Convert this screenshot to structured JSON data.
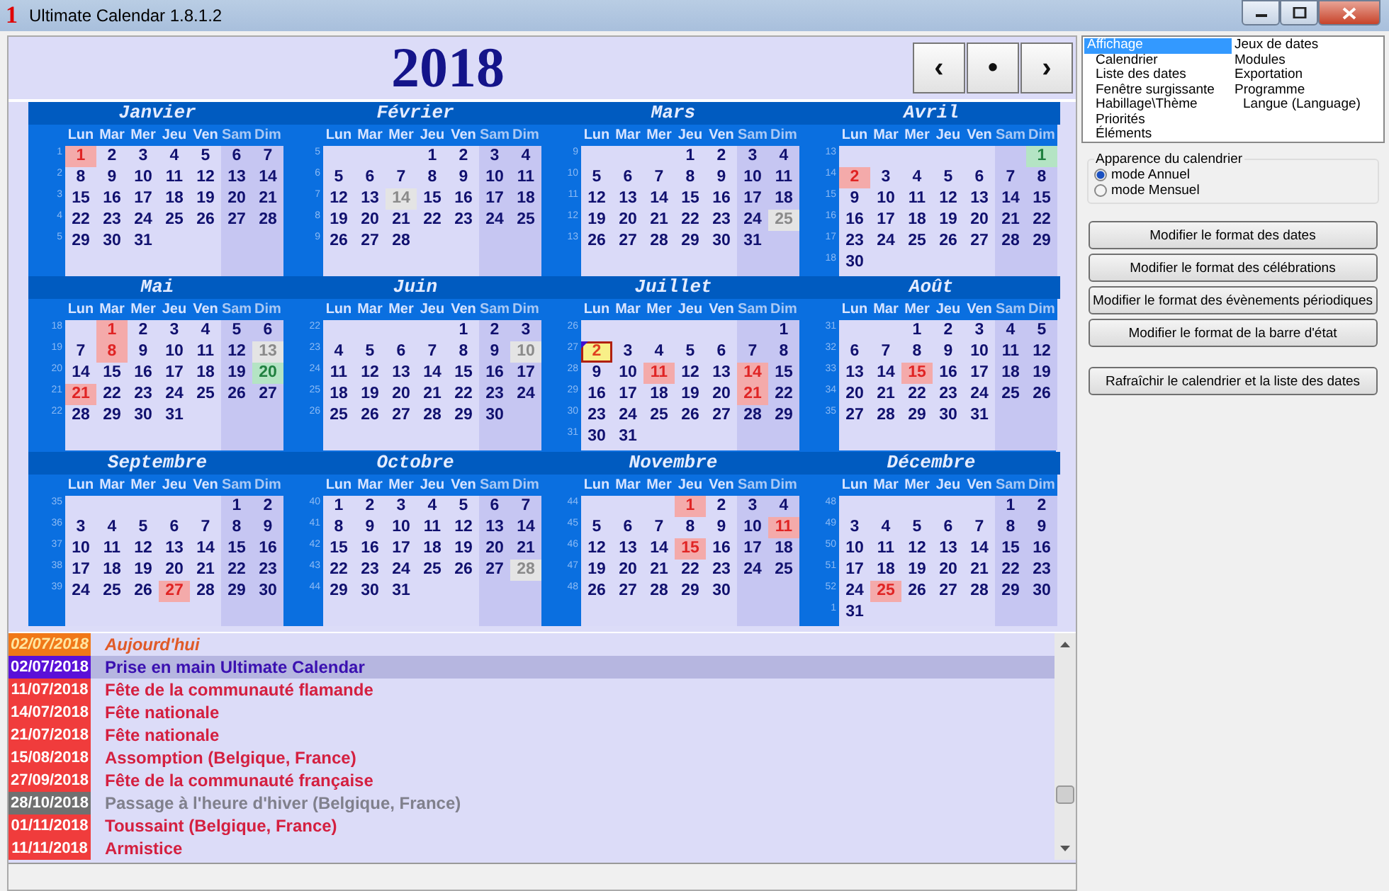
{
  "window": {
    "title": "Ultimate Calendar 1.8.1.2",
    "icon_text": "1"
  },
  "year": "2018",
  "nav_buttons": [
    "‹",
    "•",
    "›"
  ],
  "months": [
    {
      "name": "Janvier",
      "weekdays": [
        "Lun",
        "Mar",
        "Mer",
        "Jeu",
        "Ven",
        "Sam",
        "Dim"
      ],
      "weeks": [
        {
          "number": "1",
          "days": [
            {
              "d": "1",
              "kind": "holiday"
            },
            "2",
            "3",
            "4",
            "5",
            "6",
            "7"
          ]
        },
        {
          "number": "2",
          "days": [
            "8",
            "9",
            "10",
            "11",
            "12",
            "13",
            "14"
          ]
        },
        {
          "number": "3",
          "days": [
            "15",
            "16",
            "17",
            "18",
            "19",
            "20",
            "21"
          ]
        },
        {
          "number": "4",
          "days": [
            "22",
            "23",
            "24",
            "25",
            "26",
            "27",
            "28"
          ]
        },
        {
          "number": "5",
          "days": [
            "29",
            "30",
            "31"
          ]
        }
      ]
    },
    {
      "name": "Février",
      "weekdays": [
        "Lun",
        "Mar",
        "Mer",
        "Jeu",
        "Ven",
        "Sam",
        "Dim"
      ],
      "weeks": [
        {
          "number": "5",
          "days": [
            "1",
            "2",
            "3",
            "4"
          ]
        },
        {
          "number": "6",
          "days": [
            "5",
            "6",
            "7",
            "8",
            "9",
            "10",
            "11"
          ]
        },
        {
          "number": "7",
          "days": [
            "12",
            "13",
            {
              "d": "14",
              "kind": "muted"
            },
            "15",
            "16",
            "17",
            "18"
          ]
        },
        {
          "number": "8",
          "days": [
            "19",
            "20",
            "21",
            "22",
            "23",
            "24",
            "25"
          ]
        },
        {
          "number": "9",
          "days": [
            "26",
            "27",
            "28"
          ]
        }
      ]
    },
    {
      "name": "Mars",
      "weekdays": [
        "Lun",
        "Mar",
        "Mer",
        "Jeu",
        "Ven",
        "Sam",
        "Dim"
      ],
      "weeks": [
        {
          "number": "9",
          "days": [
            "1",
            "2",
            "3",
            "4"
          ]
        },
        {
          "number": "10",
          "days": [
            "5",
            "6",
            "7",
            "8",
            "9",
            "10",
            "11"
          ]
        },
        {
          "number": "11",
          "days": [
            "12",
            "13",
            "14",
            "15",
            "16",
            "17",
            "18"
          ]
        },
        {
          "number": "12",
          "days": [
            "19",
            "20",
            "21",
            "22",
            "23",
            "24",
            {
              "d": "25",
              "kind": "muted"
            }
          ]
        },
        {
          "number": "13",
          "days": [
            "26",
            "27",
            "28",
            "29",
            "30",
            "31"
          ]
        }
      ]
    },
    {
      "name": "Avril",
      "weekdays": [
        "Lun",
        "Mar",
        "Mer",
        "Jeu",
        "Ven",
        "Sam",
        "Dim"
      ],
      "weeks": [
        {
          "number": "13",
          "days": [
            {
              "d": "1",
              "kind": "green"
            }
          ]
        },
        {
          "number": "14",
          "days": [
            {
              "d": "2",
              "kind": "holiday"
            },
            "3",
            "4",
            "5",
            "6",
            "7",
            "8"
          ]
        },
        {
          "number": "15",
          "days": [
            "9",
            "10",
            "11",
            "12",
            "13",
            "14",
            "15"
          ]
        },
        {
          "number": "16",
          "days": [
            "16",
            "17",
            "18",
            "19",
            "20",
            "21",
            "22"
          ]
        },
        {
          "number": "17",
          "days": [
            "23",
            "24",
            "25",
            "26",
            "27",
            "28",
            "29"
          ]
        },
        {
          "number": "18",
          "days": [
            "30"
          ]
        }
      ]
    },
    {
      "name": "Mai",
      "weekdays": [
        "Lun",
        "Mar",
        "Mer",
        "Jeu",
        "Ven",
        "Sam",
        "Dim"
      ],
      "weeks": [
        {
          "number": "18",
          "days": [
            {
              "d": "1",
              "kind": "holiday"
            },
            "2",
            "3",
            "4",
            "5",
            "6"
          ]
        },
        {
          "number": "19",
          "days": [
            "7",
            {
              "d": "8",
              "kind": "holiday"
            },
            "9",
            "10",
            "11",
            "12",
            {
              "d": "13",
              "kind": "muted"
            }
          ]
        },
        {
          "number": "20",
          "days": [
            "14",
            "15",
            "16",
            "17",
            "18",
            "19",
            {
              "d": "20",
              "kind": "green"
            }
          ]
        },
        {
          "number": "21",
          "days": [
            {
              "d": "21",
              "kind": "holiday"
            },
            "22",
            "23",
            "24",
            "25",
            "26",
            "27"
          ]
        },
        {
          "number": "22",
          "days": [
            "28",
            "29",
            "30",
            "31"
          ]
        }
      ]
    },
    {
      "name": "Juin",
      "weekdays": [
        "Lun",
        "Mar",
        "Mer",
        "Jeu",
        "Ven",
        "Sam",
        "Dim"
      ],
      "weeks": [
        {
          "number": "22",
          "days": [
            "1",
            "2",
            "3"
          ]
        },
        {
          "number": "23",
          "days": [
            "4",
            "5",
            "6",
            "7",
            "8",
            "9",
            {
              "d": "10",
              "kind": "muted"
            }
          ]
        },
        {
          "number": "24",
          "days": [
            "11",
            "12",
            "13",
            "14",
            "15",
            "16",
            "17"
          ]
        },
        {
          "number": "25",
          "days": [
            "18",
            "19",
            "20",
            "21",
            "22",
            "23",
            "24"
          ]
        },
        {
          "number": "26",
          "days": [
            "25",
            "26",
            "27",
            "28",
            "29",
            "30"
          ]
        }
      ]
    },
    {
      "name": "Juillet",
      "weekdays": [
        "Lun",
        "Mar",
        "Mer",
        "Jeu",
        "Ven",
        "Sam",
        "Dim"
      ],
      "weeks": [
        {
          "number": "26",
          "days": [
            "1"
          ]
        },
        {
          "number": "27",
          "days": [
            {
              "d": "2",
              "kind": "today",
              "event": true
            },
            "3",
            "4",
            "5",
            "6",
            "7",
            "8"
          ]
        },
        {
          "number": "28",
          "days": [
            "9",
            "10",
            {
              "d": "11",
              "kind": "holiday"
            },
            "12",
            "13",
            {
              "d": "14",
              "kind": "holiday"
            },
            "15"
          ]
        },
        {
          "number": "29",
          "days": [
            "16",
            "17",
            "18",
            "19",
            "20",
            {
              "d": "21",
              "kind": "holiday"
            },
            "22"
          ]
        },
        {
          "number": "30",
          "days": [
            "23",
            "24",
            "25",
            "26",
            "27",
            "28",
            "29"
          ]
        },
        {
          "number": "31",
          "days": [
            "30",
            "31"
          ]
        }
      ]
    },
    {
      "name": "Août",
      "weekdays": [
        "Lun",
        "Mar",
        "Mer",
        "Jeu",
        "Ven",
        "Sam",
        "Dim"
      ],
      "weeks": [
        {
          "number": "31",
          "days": [
            "1",
            "2",
            "3",
            "4",
            "5"
          ]
        },
        {
          "number": "32",
          "days": [
            "6",
            "7",
            "8",
            "9",
            "10",
            "11",
            "12"
          ]
        },
        {
          "number": "33",
          "days": [
            "13",
            "14",
            {
              "d": "15",
              "kind": "holiday"
            },
            "16",
            "17",
            "18",
            "19"
          ]
        },
        {
          "number": "34",
          "days": [
            "20",
            "21",
            "22",
            "23",
            "24",
            "25",
            "26"
          ]
        },
        {
          "number": "35",
          "days": [
            "27",
            "28",
            "29",
            "30",
            "31"
          ]
        }
      ]
    },
    {
      "name": "Septembre",
      "weekdays": [
        "Lun",
        "Mar",
        "Mer",
        "Jeu",
        "Ven",
        "Sam",
        "Dim"
      ],
      "weeks": [
        {
          "number": "35",
          "days": [
            "1",
            "2"
          ]
        },
        {
          "number": "36",
          "days": [
            "3",
            "4",
            "5",
            "6",
            "7",
            "8",
            "9"
          ]
        },
        {
          "number": "37",
          "days": [
            "10",
            "11",
            "12",
            "13",
            "14",
            "15",
            "16"
          ]
        },
        {
          "number": "38",
          "days": [
            "17",
            "18",
            "19",
            "20",
            "21",
            "22",
            "23"
          ]
        },
        {
          "number": "39",
          "days": [
            "24",
            "25",
            "26",
            {
              "d": "27",
              "kind": "holiday"
            },
            "28",
            "29",
            "30"
          ]
        }
      ]
    },
    {
      "name": "Octobre",
      "weekdays": [
        "Lun",
        "Mar",
        "Mer",
        "Jeu",
        "Ven",
        "Sam",
        "Dim"
      ],
      "weeks": [
        {
          "number": "40",
          "days": [
            "1",
            "2",
            "3",
            "4",
            "5",
            "6",
            "7"
          ]
        },
        {
          "number": "41",
          "days": [
            "8",
            "9",
            "10",
            "11",
            "12",
            "13",
            "14"
          ]
        },
        {
          "number": "42",
          "days": [
            "15",
            "16",
            "17",
            "18",
            "19",
            "20",
            "21"
          ]
        },
        {
          "number": "43",
          "days": [
            "22",
            "23",
            "24",
            "25",
            "26",
            "27",
            {
              "d": "28",
              "kind": "muted"
            }
          ]
        },
        {
          "number": "44",
          "days": [
            "29",
            "30",
            "31"
          ]
        }
      ]
    },
    {
      "name": "Novembre",
      "weekdays": [
        "Lun",
        "Mar",
        "Mer",
        "Jeu",
        "Ven",
        "Sam",
        "Dim"
      ],
      "weeks": [
        {
          "number": "44",
          "days": [
            {
              "d": "1",
              "kind": "holiday"
            },
            "2",
            "3",
            "4"
          ]
        },
        {
          "number": "45",
          "days": [
            "5",
            "6",
            "7",
            "8",
            "9",
            "10",
            {
              "d": "11",
              "kind": "holiday"
            }
          ]
        },
        {
          "number": "46",
          "days": [
            "12",
            "13",
            "14",
            {
              "d": "15",
              "kind": "holiday"
            },
            "16",
            "17",
            "18"
          ]
        },
        {
          "number": "47",
          "days": [
            "19",
            "20",
            "21",
            "22",
            "23",
            "24",
            "25"
          ]
        },
        {
          "number": "48",
          "days": [
            "26",
            "27",
            "28",
            "29",
            "30"
          ]
        }
      ]
    },
    {
      "name": "Décembre",
      "weekdays": [
        "Lun",
        "Mar",
        "Mer",
        "Jeu",
        "Ven",
        "Sam",
        "Dim"
      ],
      "weeks": [
        {
          "number": "48",
          "days": [
            "1",
            "2"
          ]
        },
        {
          "number": "49",
          "days": [
            "3",
            "4",
            "5",
            "6",
            "7",
            "8",
            "9"
          ]
        },
        {
          "number": "50",
          "days": [
            "10",
            "11",
            "12",
            "13",
            "14",
            "15",
            "16"
          ]
        },
        {
          "number": "51",
          "days": [
            "17",
            "18",
            "19",
            "20",
            "21",
            "22",
            "23"
          ]
        },
        {
          "number": "52",
          "days": [
            "24",
            {
              "d": "25",
              "kind": "holiday"
            },
            "26",
            "27",
            "28",
            "29",
            "30"
          ]
        },
        {
          "number": "1",
          "days": [
            "31"
          ]
        }
      ]
    }
  ],
  "events": [
    {
      "date": "02/07/2018",
      "label": "Aujourd'hui",
      "kind": "today",
      "color": "#f07818",
      "selected": false
    },
    {
      "date": "02/07/2018",
      "label": "Prise en main Ultimate Calendar",
      "kind": "event",
      "color": "#5a10d8",
      "selected": true
    },
    {
      "date": "11/07/2018",
      "label": "Fête de la communauté flamande",
      "kind": "holiday",
      "color": "#f03c3c",
      "selected": false
    },
    {
      "date": "14/07/2018",
      "label": "Fête nationale",
      "kind": "holiday",
      "color": "#f03c3c",
      "selected": false
    },
    {
      "date": "21/07/2018",
      "label": "Fête nationale",
      "kind": "holiday",
      "color": "#f03c3c",
      "selected": false
    },
    {
      "date": "15/08/2018",
      "label": "Assomption (Belgique, France)",
      "kind": "holiday",
      "color": "#f03c3c",
      "selected": false
    },
    {
      "date": "27/09/2018",
      "label": "Fête de la communauté française",
      "kind": "holiday",
      "color": "#f03c3c",
      "selected": false
    },
    {
      "date": "28/10/2018",
      "label": "Passage à l'heure d'hiver (Belgique, France)",
      "kind": "dst",
      "color": "#707070",
      "selected": false
    },
    {
      "date": "01/11/2018",
      "label": "Toussaint (Belgique, France)",
      "kind": "holiday",
      "color": "#f03c3c",
      "selected": false
    },
    {
      "date": "11/11/2018",
      "label": "Armistice",
      "kind": "holiday",
      "color": "#f03c3c",
      "selected": false
    }
  ],
  "settings_menu": {
    "items": [
      {
        "label": "Affichage",
        "selected": true,
        "children": [
          {
            "label": "Calendrier",
            "selected": false
          },
          {
            "label": "Liste des dates",
            "selected": false
          },
          {
            "label": "Fenêtre surgissante",
            "selected": false
          },
          {
            "label": "Habillage\\Thème",
            "selected": false
          },
          {
            "label": "Priorités",
            "selected": false
          },
          {
            "label": "Éléments",
            "selected": false
          }
        ]
      },
      {
        "label": "Jeux de dates",
        "selected": false
      },
      {
        "label": "Modules",
        "selected": false
      },
      {
        "label": "Exportation",
        "selected": false
      },
      {
        "label": "Programme",
        "selected": false,
        "children": [
          {
            "label": "Langue (Language)",
            "selected": false
          }
        ]
      }
    ]
  },
  "appearance": {
    "title": "Apparence du calendrier",
    "options": [
      {
        "label": "mode Annuel",
        "selected": true
      },
      {
        "label": "mode Mensuel",
        "selected": false
      }
    ]
  },
  "buttons": [
    "Modifier le format des dates",
    "Modifier le format des célébrations",
    "Modifier le format des évènements périodiques",
    "Modifier le format de la barre d'état",
    "Rafraîchir le calendrier et la liste des dates"
  ]
}
